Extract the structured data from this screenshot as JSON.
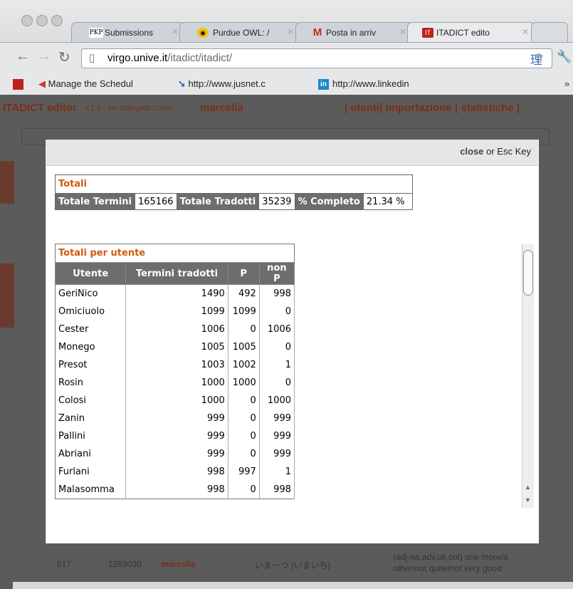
{
  "browser": {
    "tabs": [
      {
        "favicon": "PKP",
        "label": "Submissions",
        "active": false
      },
      {
        "favicon": "owl-icon",
        "label": "Purdue OWL: /",
        "active": false
      },
      {
        "favicon": "gmail-icon",
        "label": "Posta in arriv",
        "active": false
      },
      {
        "favicon": "itadict-icon",
        "label": "ITADICT edito",
        "active": true
      }
    ],
    "url_domain": "virgo.unive.it",
    "url_path": "/itadict/itadict/",
    "bookmarks": [
      {
        "label": "Manage the Schedul",
        "icon": "calendar-icon"
      },
      {
        "label": "http://www.jusnet.c",
        "icon": "arrow-icon"
      },
      {
        "label": "http://www.linkedin",
        "icon": "linkedin-icon"
      }
    ]
  },
  "page": {
    "title": "ITADICT editor",
    "version": "v.1.5",
    "logged": "- sei collegato come:",
    "user": "marcella",
    "nav": "| utenti| importazione | statistiche |"
  },
  "modal": {
    "close_label": "close",
    "close_suffix": "or Esc Key",
    "totali": {
      "caption": "Totali",
      "termini_label": "Totale Termini",
      "termini_value": "165166",
      "tradotti_label": "Totale Tradotti",
      "tradotti_value": "35239",
      "completo_label": "% Completo",
      "completo_value": "21.34 %"
    },
    "per_utente": {
      "caption": "Totali per utente",
      "headers": [
        "Utente",
        "Termini tradotti",
        "P",
        "non P"
      ],
      "rows": [
        [
          "GeriNico",
          "1490",
          "492",
          "998"
        ],
        [
          "Omiciuolo",
          "1099",
          "1099",
          "0"
        ],
        [
          "Cester",
          "1006",
          "0",
          "1006"
        ],
        [
          "Monego",
          "1005",
          "1005",
          "0"
        ],
        [
          "Presot",
          "1003",
          "1002",
          "1"
        ],
        [
          "Rosin",
          "1000",
          "1000",
          "0"
        ],
        [
          "Colosi",
          "1000",
          "0",
          "1000"
        ],
        [
          "Zanin",
          "999",
          "0",
          "999"
        ],
        [
          "Pallini",
          "999",
          "0",
          "999"
        ],
        [
          "Abriani",
          "999",
          "0",
          "999"
        ],
        [
          "Furlani",
          "998",
          "997",
          "1"
        ],
        [
          "Malasomma",
          "998",
          "0",
          "998"
        ]
      ]
    }
  },
  "background_row": {
    "id": "517",
    "number": "1289030",
    "user": "marcella",
    "term": "いまーつ [いまいち]",
    "definition_1": "(adj-na,adv,uk,col) one more/a",
    "definition_2": "other/not quite/not very good"
  },
  "colors": {
    "accent": "#d15a09",
    "header_bg": "#6d6d6d",
    "page_title": "#7b2e14"
  }
}
